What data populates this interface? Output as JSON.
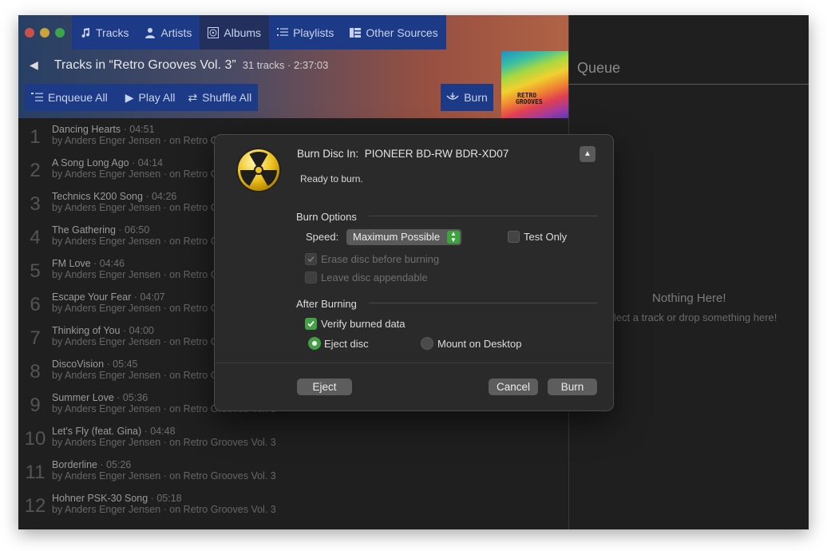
{
  "tabs": [
    {
      "label": "Tracks",
      "icon": "music-note-icon"
    },
    {
      "label": "Artists",
      "icon": "person-icon"
    },
    {
      "label": "Albums",
      "icon": "album-icon"
    },
    {
      "label": "Playlists",
      "icon": "playlist-icon"
    },
    {
      "label": "Other Sources",
      "icon": "sources-icon"
    }
  ],
  "header": {
    "title": "Tracks in “Retro Grooves Vol. 3”",
    "meta": "31 tracks · 2:37:03"
  },
  "actions": {
    "enqueue_all": "Enqueue All",
    "play_all": "Play All",
    "shuffle_all": "Shuffle All",
    "burn": "Burn"
  },
  "colors": {
    "accent": "#1d3a86",
    "check": "#43a047"
  },
  "tracks": [
    {
      "num": "1",
      "title": "Dancing Hearts",
      "dur": " · 04:51",
      "sub": "by Anders Enger Jensen · on Retro Grooves Vol. 3"
    },
    {
      "num": "2",
      "title": "A Song Long Ago",
      "dur": " · 04:14",
      "sub": "by Anders Enger Jensen · on Retro Grooves Vol. 3"
    },
    {
      "num": "3",
      "title": "Technics K200 Song",
      "dur": " · 04:26",
      "sub": "by Anders Enger Jensen · on Retro Grooves Vol. 3"
    },
    {
      "num": "4",
      "title": "The Gathering",
      "dur": " · 06:50",
      "sub": "by Anders Enger Jensen · on Retro Grooves Vol. 3"
    },
    {
      "num": "5",
      "title": "FM Love",
      "dur": " · 04:46",
      "sub": "by Anders Enger Jensen · on Retro Grooves Vol. 3"
    },
    {
      "num": "6",
      "title": "Escape Your Fear",
      "dur": " · 04:07",
      "sub": "by Anders Enger Jensen · on Retro Grooves Vol. 3"
    },
    {
      "num": "7",
      "title": "Thinking of You",
      "dur": " · 04:00",
      "sub": "by Anders Enger Jensen · on Retro Grooves Vol. 3"
    },
    {
      "num": "8",
      "title": "DiscoVision",
      "dur": " · 05:45",
      "sub": "by Anders Enger Jensen · on Retro Grooves Vol. 3"
    },
    {
      "num": "9",
      "title": "Summer Love",
      "dur": " · 05:36",
      "sub": "by Anders Enger Jensen · on Retro Grooves Vol. 3"
    },
    {
      "num": "10",
      "title": "Let's Fly (feat. Gina)",
      "dur": " · 04:48",
      "sub": "by Anders Enger Jensen · on Retro Grooves Vol. 3"
    },
    {
      "num": "11",
      "title": "Borderline",
      "dur": " · 05:26",
      "sub": "by Anders Enger Jensen · on Retro Grooves Vol. 3"
    },
    {
      "num": "12",
      "title": "Hohner PSK-30 Song",
      "dur": " · 05:18",
      "sub": "by Anders Enger Jensen · on Retro Grooves Vol. 3"
    }
  ],
  "queue": {
    "title": "Queue",
    "empty_title": "Nothing Here!",
    "empty_sub": "Select a track or drop something here!"
  },
  "dialog": {
    "title_prefix": "Burn Disc In:",
    "device": "PIONEER BD-RW BDR-XD07",
    "status": "Ready to burn.",
    "burn_options": "Burn Options",
    "speed_label": "Speed:",
    "speed_value": "Maximum Possible",
    "test_only": "Test Only",
    "erase": "Erase disc before burning",
    "leave_appendable": "Leave disc appendable",
    "after_burning": "After Burning",
    "verify": "Verify burned data",
    "eject_disc": "Eject disc",
    "mount": "Mount on Desktop",
    "eject_btn": "Eject",
    "cancel_btn": "Cancel",
    "burn_btn": "Burn",
    "test_only_checked": false,
    "erase_checked": true,
    "leave_appendable_checked": false,
    "verify_checked": true,
    "after_action": "eject"
  }
}
